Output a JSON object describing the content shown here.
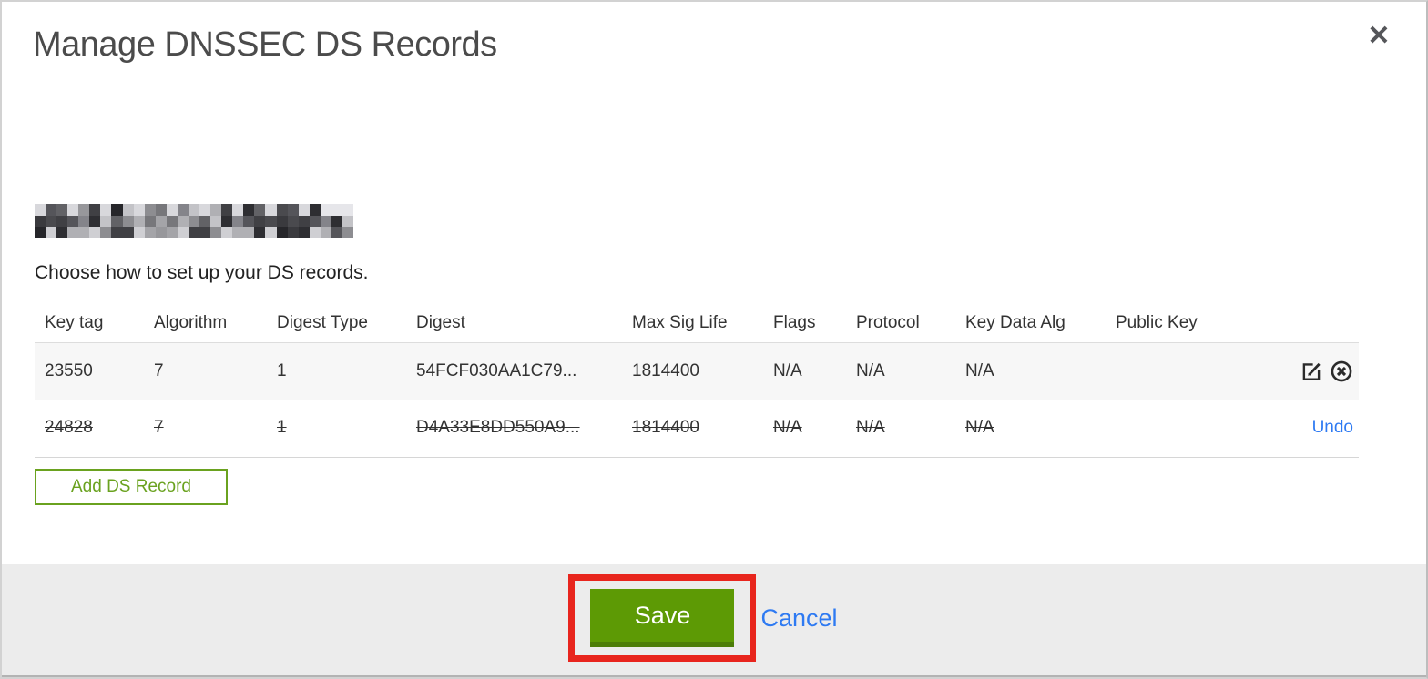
{
  "modal": {
    "title": "Manage DNSSEC DS Records",
    "instruction": "Choose how to set up your DS records.",
    "domain_name_redacted": true
  },
  "icons": {
    "close": "close-icon",
    "edit": "edit-pencil-square-icon",
    "delete": "circle-x-icon"
  },
  "table": {
    "columns": [
      "Key tag",
      "Algorithm",
      "Digest Type",
      "Digest",
      "Max Sig Life",
      "Flags",
      "Protocol",
      "Key Data Alg",
      "Public Key"
    ],
    "rows": [
      {
        "key_tag": "23550",
        "algorithm": "7",
        "digest_type": "1",
        "digest": "54FCF030AA1C79...",
        "max_sig_life": "1814400",
        "flags": "N/A",
        "protocol": "N/A",
        "key_data_alg": "N/A",
        "public_key": "",
        "state": "active",
        "actions": [
          "edit",
          "delete"
        ]
      },
      {
        "key_tag": "24828",
        "algorithm": "7",
        "digest_type": "1",
        "digest": "D4A33E8DD550A9...",
        "max_sig_life": "1814400",
        "flags": "N/A",
        "protocol": "N/A",
        "key_data_alg": "N/A",
        "public_key": "",
        "state": "marked-for-deletion",
        "action_label": "Undo"
      }
    ]
  },
  "buttons": {
    "add_ds_record": "Add DS Record",
    "save": "Save",
    "cancel": "Cancel"
  },
  "colors": {
    "button_green": "#5d9a05",
    "button_green_shadow": "#4c7d08",
    "outline_green": "#6aa21f",
    "link_blue": "#2e7af2",
    "annotation_red": "#e8251d",
    "footer_gray": "#ececec",
    "row_highlight": "#f7f7f7"
  }
}
